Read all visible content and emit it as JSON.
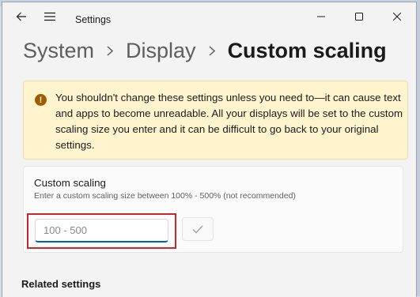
{
  "window": {
    "title": "Settings"
  },
  "breadcrumb": {
    "items": [
      "System",
      "Display"
    ],
    "current": "Custom scaling"
  },
  "warning": {
    "text": "You shouldn't change these settings unless you need to—it can cause text and apps to become unreadable. All your displays will be set to the custom scaling size you enter and it can be difficult to go back to your original settings."
  },
  "custom_scaling": {
    "title": "Custom scaling",
    "description": "Enter a custom scaling size between 100% - 500% (not recommended)",
    "input_value": "",
    "input_placeholder": "100 - 500"
  },
  "related": {
    "title": "Related settings"
  },
  "colors": {
    "accent": "#005fb8",
    "warning_bg": "#fff4ce",
    "warning_icon": "#9d5d00",
    "highlight": "#c8262b"
  }
}
